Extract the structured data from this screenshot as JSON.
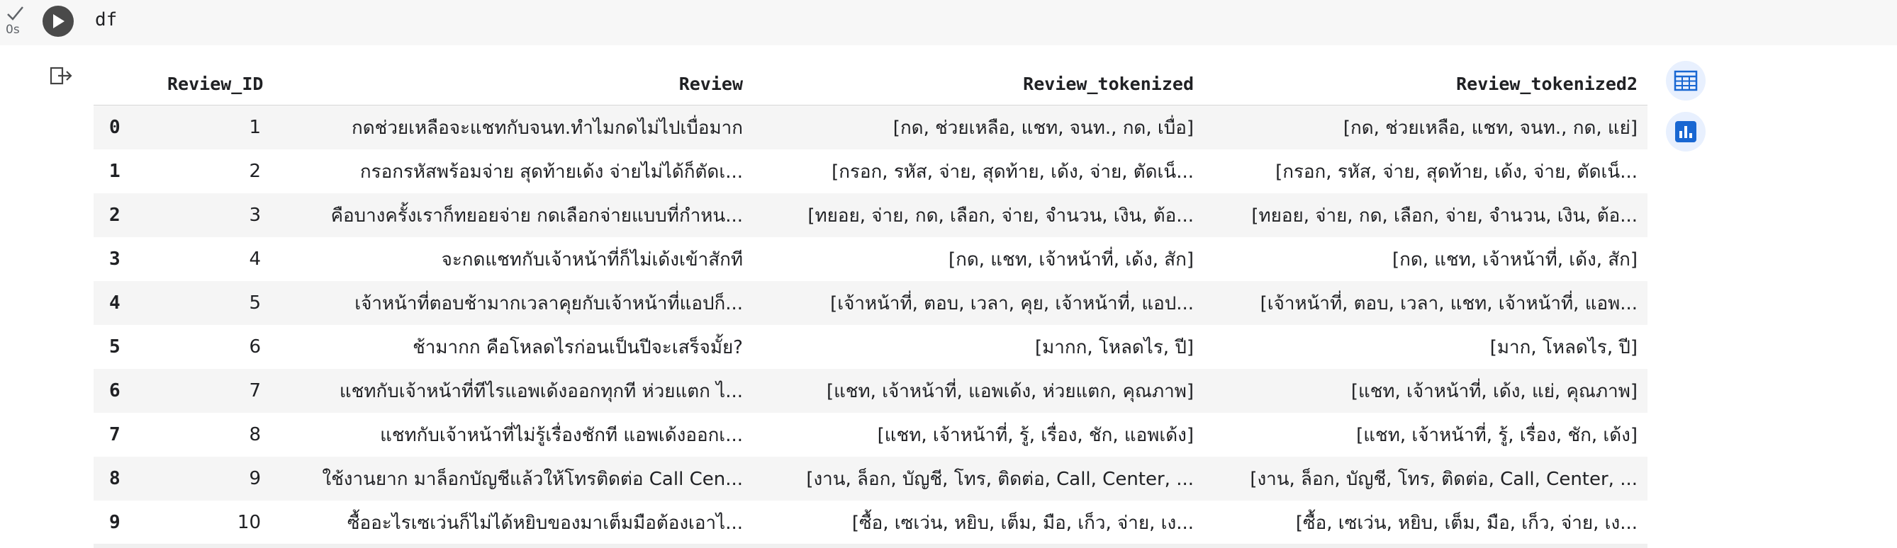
{
  "cell": {
    "status_time": "0s",
    "code": "df"
  },
  "table": {
    "columns": [
      "",
      "Review_ID",
      "Review",
      "Review_tokenized",
      "Review_tokenized2"
    ],
    "rows": [
      {
        "index": "0",
        "id": "1",
        "review": "กดช่วยเหลือจะแชทกับจนท.ทำไมกดไม่ไปเบื่อมาก",
        "tok": "[กด, ช่วยเหลือ, แชท, จนท., กด, เบื่อ]",
        "tok2": "[กด, ช่วยเหลือ, แชท, จนท., กด, แย่]"
      },
      {
        "index": "1",
        "id": "2",
        "review": "กรอกรหัสพร้อมจ่าย สุดท้ายเด้ง จ่ายไม่ได้ก็ตัดเ...",
        "tok": "[กรอก, รหัส, จ่าย, สุดท้าย, เด้ง, จ่าย, ตัดเน็...",
        "tok2": "[กรอก, รหัส, จ่าย, สุดท้าย, เด้ง, จ่าย, ตัดเน็..."
      },
      {
        "index": "2",
        "id": "3",
        "review": "คือบางครั้งเราก็ทยอยจ่าย กดเลือกจ่ายแบบที่กำหน...",
        "tok": "[ทยอย, จ่าย, กด, เลือก, จ่าย, จำนวน, เงิน, ต้อ...",
        "tok2": "[ทยอย, จ่าย, กด, เลือก, จ่าย, จำนวน, เงิน, ต้อ..."
      },
      {
        "index": "3",
        "id": "4",
        "review": "จะกดแชทกับเจ้าหน้าที่ก็ไม่เด้งเข้าสักที",
        "tok": "[กด, แชท, เจ้าหน้าที่, เด้ง, สัก]",
        "tok2": "[กด, แชท, เจ้าหน้าที่, เด้ง, สัก]"
      },
      {
        "index": "4",
        "id": "5",
        "review": "เจ้าหน้าที่ตอบช้ามากเวลาคุยกับเจ้าหน้าที่แอปก็...",
        "tok": "[เจ้าหน้าที่, ตอบ, เวลา, คุย, เจ้าหน้าที่, แอป...",
        "tok2": "[เจ้าหน้าที่, ตอบ, เวลา, แชท, เจ้าหน้าที่, แอพ..."
      },
      {
        "index": "5",
        "id": "6",
        "review": "ช้ามากก คือโหลดไรก่อนเป็นปีจะเสร็จมั้ย?",
        "tok": "[มากก, โหลดไร, ปี]",
        "tok2": "[มาก, โหลดไร, ปี]"
      },
      {
        "index": "6",
        "id": "7",
        "review": "แชทกับเจ้าหน้าที่ทีไรแอพเด้งออกทุกที ห่วยแตก ไ...",
        "tok": "[แชท, เจ้าหน้าที่, แอพเด้ง, ห่วยแตก, คุณภาพ]",
        "tok2": "[แชท, เจ้าหน้าที่, เด้ง, แย่, คุณภาพ]"
      },
      {
        "index": "7",
        "id": "8",
        "review": "แชทกับเจ้าหน้าที่ไม่รู้เรื่องชักที แอพเด้งออกเ...",
        "tok": "[แชท, เจ้าหน้าที่, รู้, เรื่อง, ชัก, แอพเด้ง]",
        "tok2": "[แชท, เจ้าหน้าที่, รู้, เรื่อง, ชัก, เด้ง]"
      },
      {
        "index": "8",
        "id": "9",
        "review": "ใช้งานยาก มาล็อกบัญชีแล้วให้โทรติดต่อ Call Cen...",
        "tok": "[งาน, ล็อก, บัญชี, โทร, ติดต่อ, Call, Center, ...",
        "tok2": "[งาน, ล็อก, บัญชี, โทร, ติดต่อ, Call, Center, ..."
      },
      {
        "index": "9",
        "id": "10",
        "review": "ซื้ออะไรเซเว่นก็ไม่ได้หยิบของมาเต็มมือต้องเอาไ...",
        "tok": "[ซื้อ, เซเว่น, หยิบ, เต็ม, มือ, เก็ว, จ่าย, เง...",
        "tok2": "[ซื้อ, เซเว่น, หยิบ, เต็ม, มือ, เก็ว, จ่าย, เง..."
      }
    ]
  },
  "colors": {
    "accent": "#1967d2",
    "check": "#34a853"
  },
  "icons": {
    "status": "check-icon",
    "run": "play-icon",
    "output": "output-exit-icon",
    "table_view": "table-icon",
    "chart_suggest": "bar-chart-icon"
  }
}
